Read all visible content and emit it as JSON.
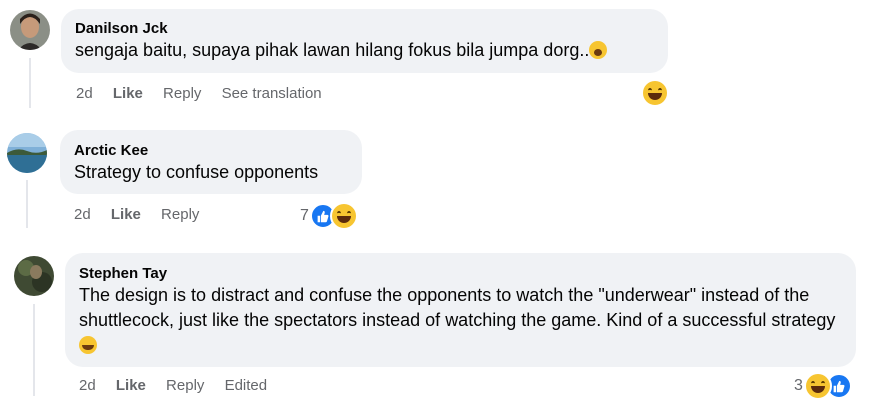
{
  "comments": [
    {
      "author": "Danilson Jck",
      "text": "sengaja baitu, supaya pihak lawan hilang fokus bila jumpa dorg..",
      "time": "2d",
      "like_label": "Like",
      "reply_label": "Reply",
      "extra_label": "See translation",
      "reaction_count": "",
      "inline_emoji": "astonished-icon"
    },
    {
      "author": "Arctic Kee",
      "text": "Strategy to confuse opponents",
      "time": "2d",
      "like_label": "Like",
      "reply_label": "Reply",
      "reaction_count": "7"
    },
    {
      "author": "Stephen Tay",
      "text": "The design is to distract and confuse the opponents to watch the \"underwear\" instead of the shuttlecock, just like the spectators instead of watching the game. Kind of a successful strategy",
      "time": "2d",
      "like_label": "Like",
      "reply_label": "Reply",
      "extra_label": "Edited",
      "reaction_count": "3",
      "inline_emoji": "laughing-icon"
    }
  ],
  "colors": {
    "bubble": "#f0f2f5",
    "meta_text": "#65676b",
    "like_blue": "#1877f2",
    "haha_yellow": "#f7c531"
  }
}
